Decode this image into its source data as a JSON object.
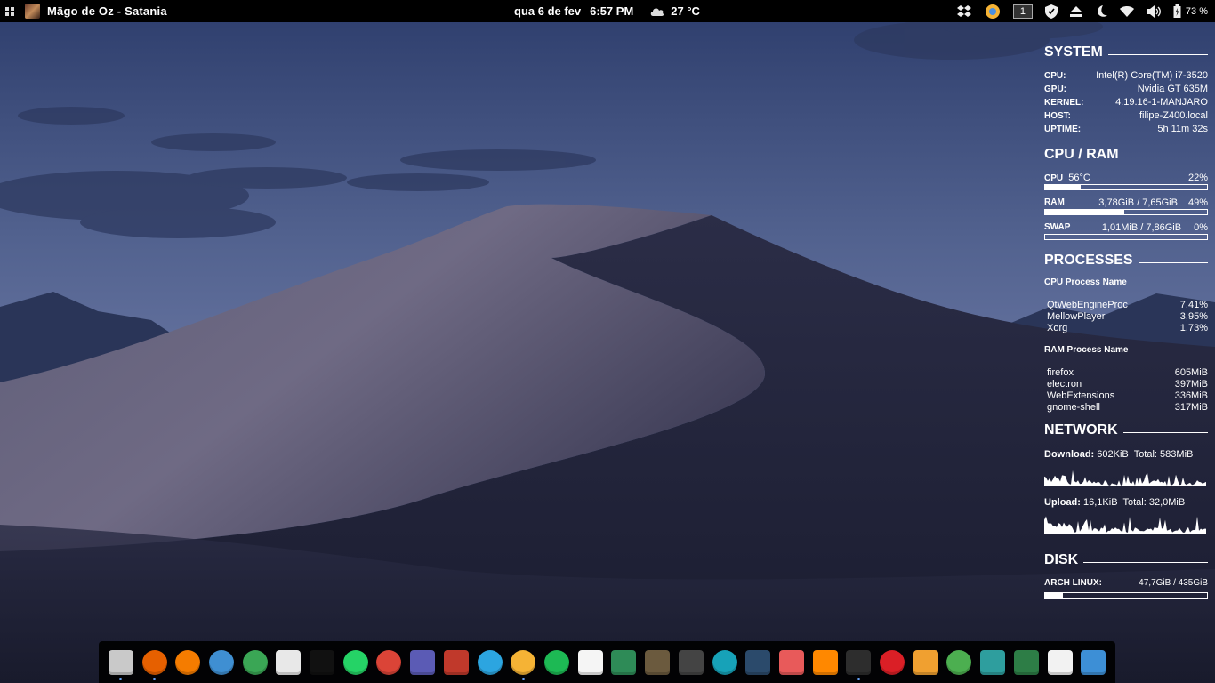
{
  "topbar": {
    "app_title": "Mägo de Oz  -  Satania",
    "date": "qua 6 de fev",
    "time": "6:57 PM",
    "weather": "27 °C",
    "workspace": "1",
    "battery": "73 %"
  },
  "system": {
    "title": "SYSTEM",
    "rows": [
      {
        "k": "CPU:",
        "v": "Intel(R) Core(TM) i7-3520"
      },
      {
        "k": "GPU:",
        "v": "Nvidia GT 635M"
      },
      {
        "k": "KERNEL:",
        "v": "4.19.16-1-MANJARO"
      },
      {
        "k": "HOST:",
        "v": "filipe-Z400.local"
      },
      {
        "k": "UPTIME:",
        "v": "5h 11m 32s"
      }
    ]
  },
  "cpuram": {
    "title": "CPU / RAM",
    "cpu": {
      "label": "CPU",
      "temp": "56°C",
      "pct": "22%",
      "fill": 0.22
    },
    "ram": {
      "label": "RAM",
      "used": "3,78GiB / 7,65GiB",
      "pct": "49%",
      "fill": 0.49
    },
    "swap": {
      "label": "SWAP",
      "used": "1,01MiB / 7,86GiB",
      "pct": "0%",
      "fill": 0.0
    }
  },
  "processes": {
    "title": "PROCESSES",
    "cpu_head": "CPU Process Name",
    "cpu_list": [
      {
        "name": "QtWebEngineProc",
        "val": "7,41%"
      },
      {
        "name": "MellowPlayer",
        "val": "3,95%"
      },
      {
        "name": "Xorg",
        "val": "1,73%"
      }
    ],
    "ram_head": "RAM Process Name",
    "ram_list": [
      {
        "name": "firefox",
        "val": "605MiB"
      },
      {
        "name": "electron",
        "val": "397MiB"
      },
      {
        "name": "WebExtensions",
        "val": "336MiB"
      },
      {
        "name": "gnome-shell",
        "val": "317MiB"
      }
    ]
  },
  "network": {
    "title": "NETWORK",
    "download_label": "Download:",
    "download_rate": "602KiB",
    "download_total_label": "Total:",
    "download_total": "583MiB",
    "upload_label": "Upload:",
    "upload_rate": "16,1KiB",
    "upload_total_label": "Total:",
    "upload_total": "32,0MiB"
  },
  "disk": {
    "title": "DISK",
    "label": "ARCH LINUX:",
    "value": "47,7GiB / 435GiB",
    "fill": 0.11
  },
  "dock": {
    "apps": [
      {
        "name": "files-icon",
        "color": "#c9c9c9",
        "dot": true
      },
      {
        "name": "firefox-icon",
        "color": "#e66000",
        "dot": true
      },
      {
        "name": "rss-reader-icon",
        "color": "#f57c00",
        "dot": false
      },
      {
        "name": "thunderbird-icon",
        "color": "#3f8fd2",
        "dot": false
      },
      {
        "name": "atom-icon",
        "color": "#3aa655",
        "dot": false
      },
      {
        "name": "document-viewer-icon",
        "color": "#e8e8e8",
        "dot": false
      },
      {
        "name": "mosaic-app-icon",
        "color": "#111111",
        "dot": false
      },
      {
        "name": "whatsapp-icon",
        "color": "#25d366",
        "dot": false
      },
      {
        "name": "chrome-icon",
        "color": "#db4437",
        "dot": false
      },
      {
        "name": "tex-icon",
        "color": "#5b5bb5",
        "dot": false
      },
      {
        "name": "library-icon",
        "color": "#c0392b",
        "dot": false
      },
      {
        "name": "telegram-icon",
        "color": "#2ca5e0",
        "dot": false
      },
      {
        "name": "mellowplayer-icon",
        "color": "#f5b335",
        "dot": true
      },
      {
        "name": "spotify-icon",
        "color": "#1db954",
        "dot": false
      },
      {
        "name": "wps-icon",
        "color": "#f5f5f5",
        "dot": false
      },
      {
        "name": "spreadsheet-icon",
        "color": "#2e8b57",
        "dot": false
      },
      {
        "name": "gimp-icon",
        "color": "#6b5a3e",
        "dot": false
      },
      {
        "name": "inkscape-icon",
        "color": "#444444",
        "dot": false
      },
      {
        "name": "pcloud-icon",
        "color": "#17a2b8",
        "dot": false
      },
      {
        "name": "screenshot-icon",
        "color": "#2b4a6b",
        "dot": false
      },
      {
        "name": "image-viewer-icon",
        "color": "#e85a5a",
        "dot": false
      },
      {
        "name": "vlc-icon",
        "color": "#ff8800",
        "dot": false
      },
      {
        "name": "terminal-icon",
        "color": "#2d2d2d",
        "dot": true
      },
      {
        "name": "creative-cloud-icon",
        "color": "#da1f26",
        "dot": false
      },
      {
        "name": "downloader-icon",
        "color": "#f0a030",
        "dot": false
      },
      {
        "name": "gnome-tweaks-icon",
        "color": "#4caf50",
        "dot": false
      },
      {
        "name": "settings-wrench-icon",
        "color": "#2e9e9e",
        "dot": false
      },
      {
        "name": "system-monitor-icon",
        "color": "#2d7d46",
        "dot": false
      },
      {
        "name": "package-manager-icon",
        "color": "#f2f2f2",
        "dot": false
      },
      {
        "name": "show-desktop-icon",
        "color": "#3d8fd6",
        "dot": false
      }
    ]
  }
}
